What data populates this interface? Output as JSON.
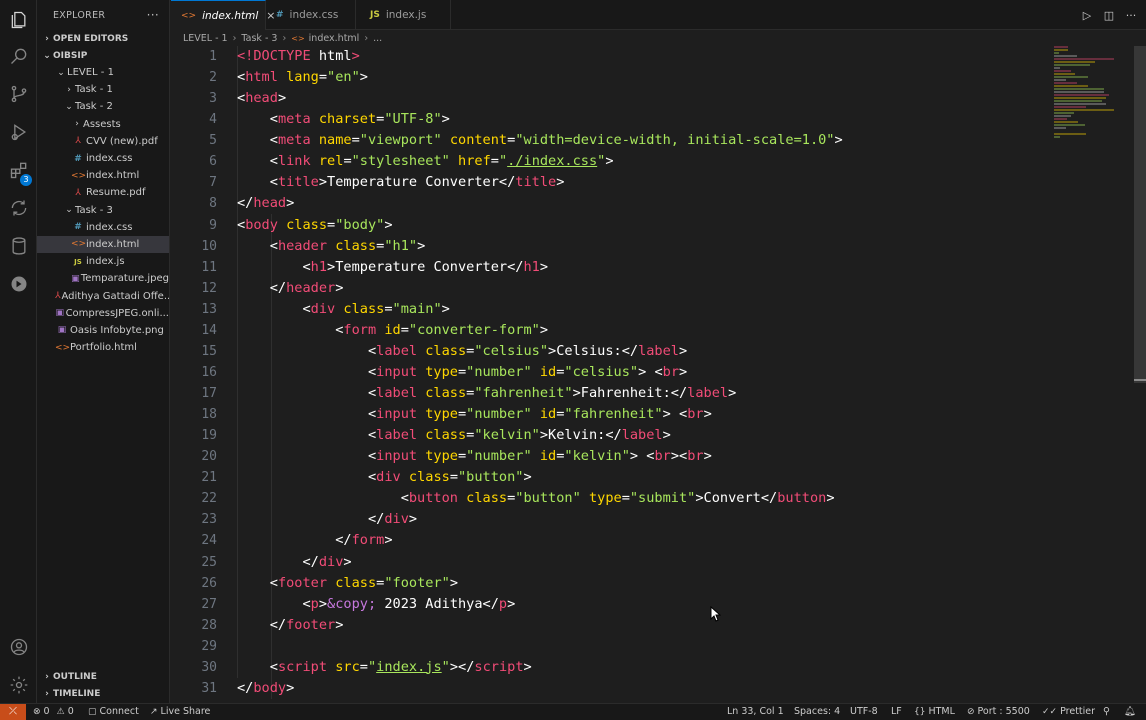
{
  "activity_bar": {
    "items": [
      "explorer-icon",
      "search-icon",
      "source-control-icon",
      "run-debug-icon",
      "extensions-icon",
      "remote-explorer-icon",
      "database-icon",
      "live-share-icon"
    ],
    "extensions_badge": "3",
    "bottom": [
      "account-icon",
      "settings-gear-icon"
    ]
  },
  "sidebar": {
    "title": "EXPLORER",
    "more": "···",
    "sections": {
      "open_editors": "OPEN EDITORS",
      "root": "OIBSIP",
      "outline": "OUTLINE",
      "timeline": "TIMELINE"
    },
    "tree": [
      {
        "label": "LEVEL - 1",
        "icon": "chevron-down",
        "depth": 1
      },
      {
        "label": "Task - 1",
        "icon": "chevron-right",
        "depth": 2
      },
      {
        "label": "Task - 2",
        "icon": "chevron-down",
        "depth": 2
      },
      {
        "label": "Assests",
        "icon": "chevron-right",
        "depth": 3
      },
      {
        "label": "CVV (new).pdf",
        "icon": "pdf",
        "depth": 3
      },
      {
        "label": "index.css",
        "icon": "css",
        "depth": 3
      },
      {
        "label": "index.html",
        "icon": "html",
        "depth": 3
      },
      {
        "label": "Resume.pdf",
        "icon": "pdf",
        "depth": 3
      },
      {
        "label": "Task - 3",
        "icon": "chevron-down",
        "depth": 2
      },
      {
        "label": "index.css",
        "icon": "css",
        "depth": 3
      },
      {
        "label": "index.html",
        "icon": "html",
        "depth": 3,
        "active": true
      },
      {
        "label": "index.js",
        "icon": "js",
        "depth": 3
      },
      {
        "label": "Temparature.jpeg",
        "icon": "img",
        "depth": 3
      },
      {
        "label": "Adithya Gattadi Offe...",
        "icon": "pdf",
        "depth": 1
      },
      {
        "label": "CompressJPEG.onli...",
        "icon": "img",
        "depth": 1
      },
      {
        "label": "Oasis Infobyte.png",
        "icon": "img",
        "depth": 1
      },
      {
        "label": "Portfolio.html",
        "icon": "html",
        "depth": 1
      }
    ]
  },
  "tabs": [
    {
      "label": "index.html",
      "icon": "html",
      "active": true,
      "close": "×"
    },
    {
      "label": "index.css",
      "icon": "css",
      "active": false
    },
    {
      "label": "index.js",
      "icon": "js",
      "active": false
    }
  ],
  "tab_actions": [
    "run-icon",
    "split-editor-icon",
    "more-actions-icon"
  ],
  "breadcrumb": {
    "items": [
      "LEVEL - 1",
      "Task - 3",
      "index.html",
      "..."
    ],
    "sep": "›"
  },
  "editor": {
    "first_line": 1,
    "current_line": 33,
    "lines": [
      [
        [
          "t",
          "<!"
        ],
        [
          "g",
          "DOCTYPE"
        ],
        [
          "w",
          " html"
        ],
        [
          "t",
          ">"
        ]
      ],
      [
        [
          "w",
          "<"
        ],
        [
          "t",
          "html"
        ],
        [
          "a",
          " lang"
        ],
        [
          "w",
          "="
        ],
        [
          "s",
          "\"en\""
        ],
        [
          "w",
          ">"
        ]
      ],
      [
        [
          "w",
          "<"
        ],
        [
          "t",
          "head"
        ],
        [
          "w",
          ">"
        ]
      ],
      [
        [
          "i",
          "    "
        ],
        [
          "w",
          "<"
        ],
        [
          "t",
          "meta"
        ],
        [
          "a",
          " charset"
        ],
        [
          "w",
          "="
        ],
        [
          "s",
          "\"UTF-8\""
        ],
        [
          "w",
          ">"
        ]
      ],
      [
        [
          "i",
          "    "
        ],
        [
          "w",
          "<"
        ],
        [
          "t",
          "meta"
        ],
        [
          "a",
          " name"
        ],
        [
          "w",
          "="
        ],
        [
          "s",
          "\"viewport\""
        ],
        [
          "a",
          " content"
        ],
        [
          "w",
          "="
        ],
        [
          "s",
          "\"width=device-width, initial-scale=1.0\""
        ],
        [
          "w",
          ">"
        ]
      ],
      [
        [
          "i",
          "    "
        ],
        [
          "w",
          "<"
        ],
        [
          "t",
          "link"
        ],
        [
          "a",
          " rel"
        ],
        [
          "w",
          "="
        ],
        [
          "s",
          "\"stylesheet\""
        ],
        [
          "a",
          " href"
        ],
        [
          "w",
          "="
        ],
        [
          "s",
          "\""
        ],
        [
          "u",
          "./index.css"
        ],
        [
          "s",
          "\""
        ],
        [
          "w",
          ">"
        ]
      ],
      [
        [
          "i",
          "    "
        ],
        [
          "w",
          "<"
        ],
        [
          "t",
          "title"
        ],
        [
          "w",
          ">Temperature Converter</"
        ],
        [
          "t",
          "title"
        ],
        [
          "w",
          ">"
        ]
      ],
      [
        [
          "w",
          "</"
        ],
        [
          "t",
          "head"
        ],
        [
          "w",
          ">"
        ]
      ],
      [
        [
          "w",
          "<"
        ],
        [
          "t",
          "body"
        ],
        [
          "a",
          " class"
        ],
        [
          "w",
          "="
        ],
        [
          "s",
          "\"body\""
        ],
        [
          "w",
          ">"
        ]
      ],
      [
        [
          "i",
          "    "
        ],
        [
          "w",
          "<"
        ],
        [
          "t",
          "header"
        ],
        [
          "a",
          " class"
        ],
        [
          "w",
          "="
        ],
        [
          "s",
          "\"h1\""
        ],
        [
          "w",
          ">"
        ]
      ],
      [
        [
          "i",
          "        "
        ],
        [
          "w",
          "<"
        ],
        [
          "t",
          "h1"
        ],
        [
          "w",
          ">Temperature Converter</"
        ],
        [
          "t",
          "h1"
        ],
        [
          "w",
          ">"
        ]
      ],
      [
        [
          "i",
          "    "
        ],
        [
          "w",
          "</"
        ],
        [
          "t",
          "header"
        ],
        [
          "w",
          ">"
        ]
      ],
      [
        [
          "i",
          "        "
        ],
        [
          "w",
          "<"
        ],
        [
          "t",
          "div"
        ],
        [
          "a",
          " class"
        ],
        [
          "w",
          "="
        ],
        [
          "s",
          "\"main\""
        ],
        [
          "w",
          ">"
        ]
      ],
      [
        [
          "i",
          "            "
        ],
        [
          "w",
          "<"
        ],
        [
          "t",
          "form"
        ],
        [
          "a",
          " id"
        ],
        [
          "w",
          "="
        ],
        [
          "s",
          "\"converter-form\""
        ],
        [
          "w",
          ">"
        ]
      ],
      [
        [
          "i",
          "                "
        ],
        [
          "w",
          "<"
        ],
        [
          "t",
          "label"
        ],
        [
          "a",
          " class"
        ],
        [
          "w",
          "="
        ],
        [
          "s",
          "\"celsius\""
        ],
        [
          "w",
          ">Celsius:</"
        ],
        [
          "t",
          "label"
        ],
        [
          "w",
          ">"
        ]
      ],
      [
        [
          "i",
          "                "
        ],
        [
          "w",
          "<"
        ],
        [
          "t",
          "input"
        ],
        [
          "a",
          " type"
        ],
        [
          "w",
          "="
        ],
        [
          "s",
          "\"number\""
        ],
        [
          "a",
          " id"
        ],
        [
          "w",
          "="
        ],
        [
          "s",
          "\"celsius\""
        ],
        [
          "w",
          "> <"
        ],
        [
          "t",
          "br"
        ],
        [
          "w",
          ">"
        ]
      ],
      [
        [
          "i",
          "                "
        ],
        [
          "w",
          "<"
        ],
        [
          "t",
          "label"
        ],
        [
          "a",
          " class"
        ],
        [
          "w",
          "="
        ],
        [
          "s",
          "\"fahrenheit\""
        ],
        [
          "w",
          ">Fahrenheit:</"
        ],
        [
          "t",
          "label"
        ],
        [
          "w",
          ">"
        ]
      ],
      [
        [
          "i",
          "                "
        ],
        [
          "w",
          "<"
        ],
        [
          "t",
          "input"
        ],
        [
          "a",
          " type"
        ],
        [
          "w",
          "="
        ],
        [
          "s",
          "\"number\""
        ],
        [
          "a",
          " id"
        ],
        [
          "w",
          "="
        ],
        [
          "s",
          "\"fahrenheit\""
        ],
        [
          "w",
          "> <"
        ],
        [
          "t",
          "br"
        ],
        [
          "w",
          ">"
        ]
      ],
      [
        [
          "i",
          "                "
        ],
        [
          "w",
          "<"
        ],
        [
          "t",
          "label"
        ],
        [
          "a",
          " class"
        ],
        [
          "w",
          "="
        ],
        [
          "s",
          "\"kelvin\""
        ],
        [
          "w",
          ">Kelvin:</"
        ],
        [
          "t",
          "label"
        ],
        [
          "w",
          ">"
        ]
      ],
      [
        [
          "i",
          "                "
        ],
        [
          "w",
          "<"
        ],
        [
          "t",
          "input"
        ],
        [
          "a",
          " type"
        ],
        [
          "w",
          "="
        ],
        [
          "s",
          "\"number\""
        ],
        [
          "a",
          " id"
        ],
        [
          "w",
          "="
        ],
        [
          "s",
          "\"kelvin\""
        ],
        [
          "w",
          "> <"
        ],
        [
          "t",
          "br"
        ],
        [
          "w",
          "><"
        ],
        [
          "t",
          "br"
        ],
        [
          "w",
          ">"
        ]
      ],
      [
        [
          "i",
          "                "
        ],
        [
          "w",
          "<"
        ],
        [
          "t",
          "div"
        ],
        [
          "a",
          " class"
        ],
        [
          "w",
          "="
        ],
        [
          "s",
          "\"button\""
        ],
        [
          "w",
          ">"
        ]
      ],
      [
        [
          "i",
          "                    "
        ],
        [
          "w",
          "<"
        ],
        [
          "t",
          "button"
        ],
        [
          "a",
          " class"
        ],
        [
          "w",
          "="
        ],
        [
          "s",
          "\"button\""
        ],
        [
          "a",
          " type"
        ],
        [
          "w",
          "="
        ],
        [
          "s",
          "\"submit\""
        ],
        [
          "w",
          ">Convert</"
        ],
        [
          "t",
          "button"
        ],
        [
          "w",
          ">"
        ]
      ],
      [
        [
          "i",
          "                "
        ],
        [
          "w",
          "</"
        ],
        [
          "t",
          "div"
        ],
        [
          "w",
          ">"
        ]
      ],
      [
        [
          "i",
          "            "
        ],
        [
          "w",
          "</"
        ],
        [
          "t",
          "form"
        ],
        [
          "w",
          ">"
        ]
      ],
      [
        [
          "i",
          "        "
        ],
        [
          "w",
          "</"
        ],
        [
          "t",
          "div"
        ],
        [
          "w",
          ">"
        ]
      ],
      [
        [
          "i",
          "    "
        ],
        [
          "w",
          "<"
        ],
        [
          "t",
          "footer"
        ],
        [
          "a",
          " class"
        ],
        [
          "w",
          "="
        ],
        [
          "s",
          "\"footer\""
        ],
        [
          "w",
          ">"
        ]
      ],
      [
        [
          "i",
          "        "
        ],
        [
          "w",
          "<"
        ],
        [
          "t",
          "p"
        ],
        [
          "w",
          ">"
        ],
        [
          "e",
          "&copy;"
        ],
        [
          "w",
          " 2023 Adithya</"
        ],
        [
          "t",
          "p"
        ],
        [
          "w",
          ">"
        ]
      ],
      [
        [
          "i",
          "    "
        ],
        [
          "w",
          "</"
        ],
        [
          "t",
          "footer"
        ],
        [
          "w",
          ">"
        ]
      ],
      [
        [
          "w",
          ""
        ]
      ],
      [
        [
          "i",
          "    "
        ],
        [
          "w",
          "<"
        ],
        [
          "t",
          "script"
        ],
        [
          "a",
          " src"
        ],
        [
          "w",
          "="
        ],
        [
          "s",
          "\""
        ],
        [
          "u",
          "index.js"
        ],
        [
          "s",
          "\""
        ],
        [
          "w",
          "></"
        ],
        [
          "t",
          "script"
        ],
        [
          "w",
          ">"
        ]
      ],
      [
        [
          "w",
          "</"
        ],
        [
          "t",
          "body"
        ],
        [
          "w",
          ">"
        ]
      ]
    ]
  },
  "status_bar": {
    "remote": "⤫",
    "errors": "0",
    "warnings": "0",
    "connect": "Connect",
    "live_share": "Live Share",
    "position": "Ln 33, Col 1",
    "spaces": "Spaces: 4",
    "encoding": "UTF-8",
    "eol": "LF",
    "language": "HTML",
    "port": "Port : 5500",
    "prettier": "Prettier"
  },
  "colors": {
    "tag": "#f14c77",
    "attr": "#ffd700",
    "string": "#a8e65c",
    "entity": "#c678dd",
    "accent": "#0078d4",
    "remote": "#c84d1a"
  }
}
